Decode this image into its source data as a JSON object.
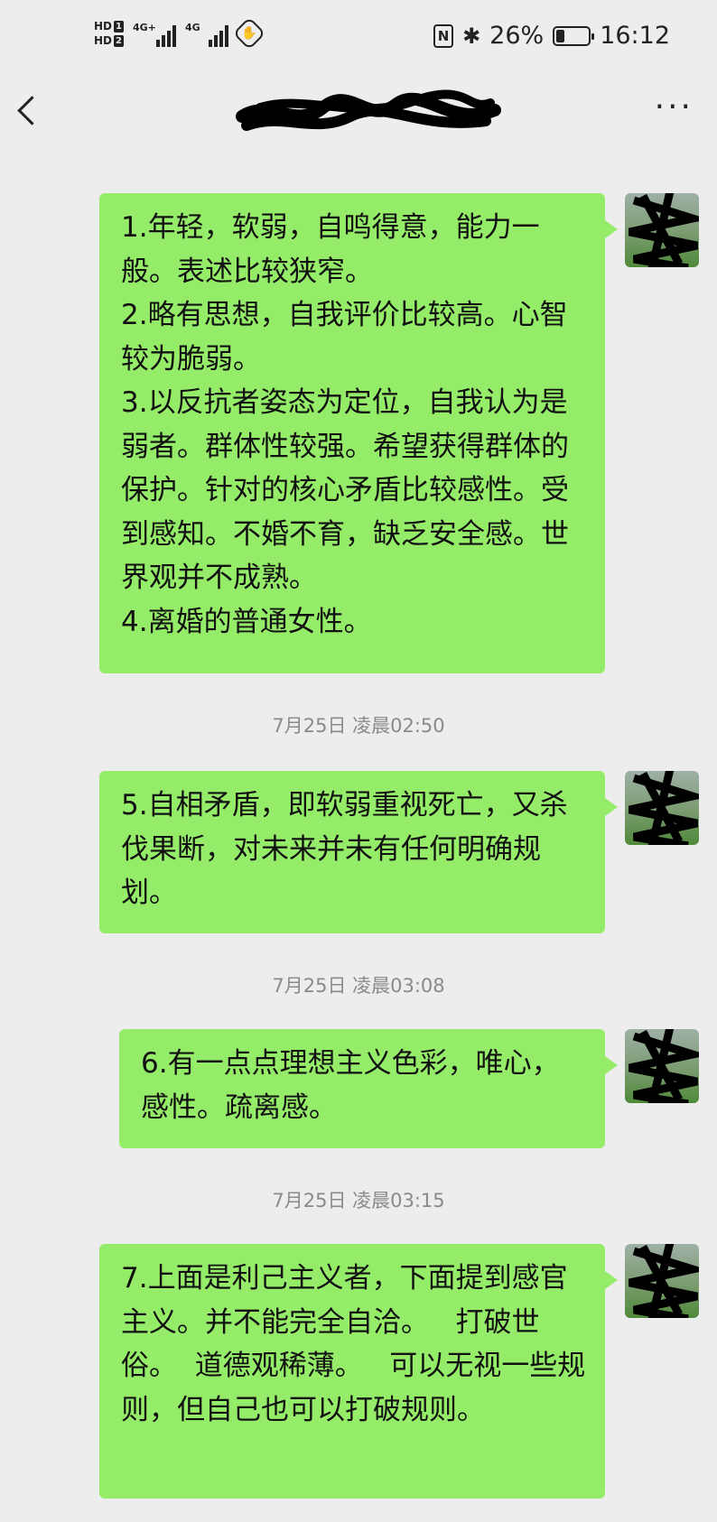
{
  "status_bar": {
    "sim1": "HD",
    "sim1_num": "1",
    "sim2": "HD",
    "sim2_num": "2",
    "net1": "4G+",
    "net2": "4G",
    "nfc": "N",
    "battery_percent": "26%",
    "battery_level": 0.26,
    "time": "16:12"
  },
  "nav": {
    "back_icon": "chevron-left-icon",
    "more_label": "···"
  },
  "colors": {
    "bubble": "#95ec69",
    "background": "#ededed",
    "timestamp": "#8a8a8a"
  },
  "messages": [
    {
      "text": "1.年轻，软弱，自鸣得意，能力一般。表述比较狭窄。\n2.略有思想，自我评价比较高。心智较为脆弱。\n3.以反抗者姿态为定位，自我认为是弱者。群体性较强。希望获得群体的保护。针对的核心矛盾比较感性。受到感知。不婚不育，缺乏安全感。世界观并不成熟。\n4.离婚的普通女性。"
    },
    {
      "text": "5.自相矛盾，即软弱重视死亡，又杀伐果断，对未来并未有任何明确规划。"
    },
    {
      "text": "6.有一点点理想主义色彩，唯心，感性。疏离感。"
    },
    {
      "text": "7.上面是利己主义者，下面提到感官主义。并不能完全自洽。   打破世俗。  道德观稀薄。   可以无视一些规则，但自己也可以打破规则。"
    }
  ],
  "timestamps": [
    "7月25日 凌晨02:50",
    "7月25日 凌晨03:08",
    "7月25日 凌晨03:15"
  ]
}
